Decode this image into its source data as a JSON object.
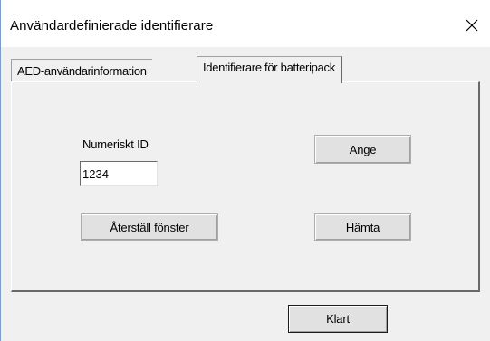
{
  "window": {
    "title": "Användardefinierade identifierare",
    "close_glyph": "×"
  },
  "tabs": [
    {
      "label": "AED-användarinformation",
      "active": false
    },
    {
      "label": "Identifierare för batteripack",
      "active": true
    }
  ],
  "form": {
    "numeric_id_label": "Numeriskt ID",
    "numeric_id_value": "1234",
    "set_button": "Ange",
    "reset_button": "Återställ fönster",
    "fetch_button": "Hämta"
  },
  "footer": {
    "done_button": "Klart"
  },
  "icons": {
    "close": "close-icon"
  }
}
